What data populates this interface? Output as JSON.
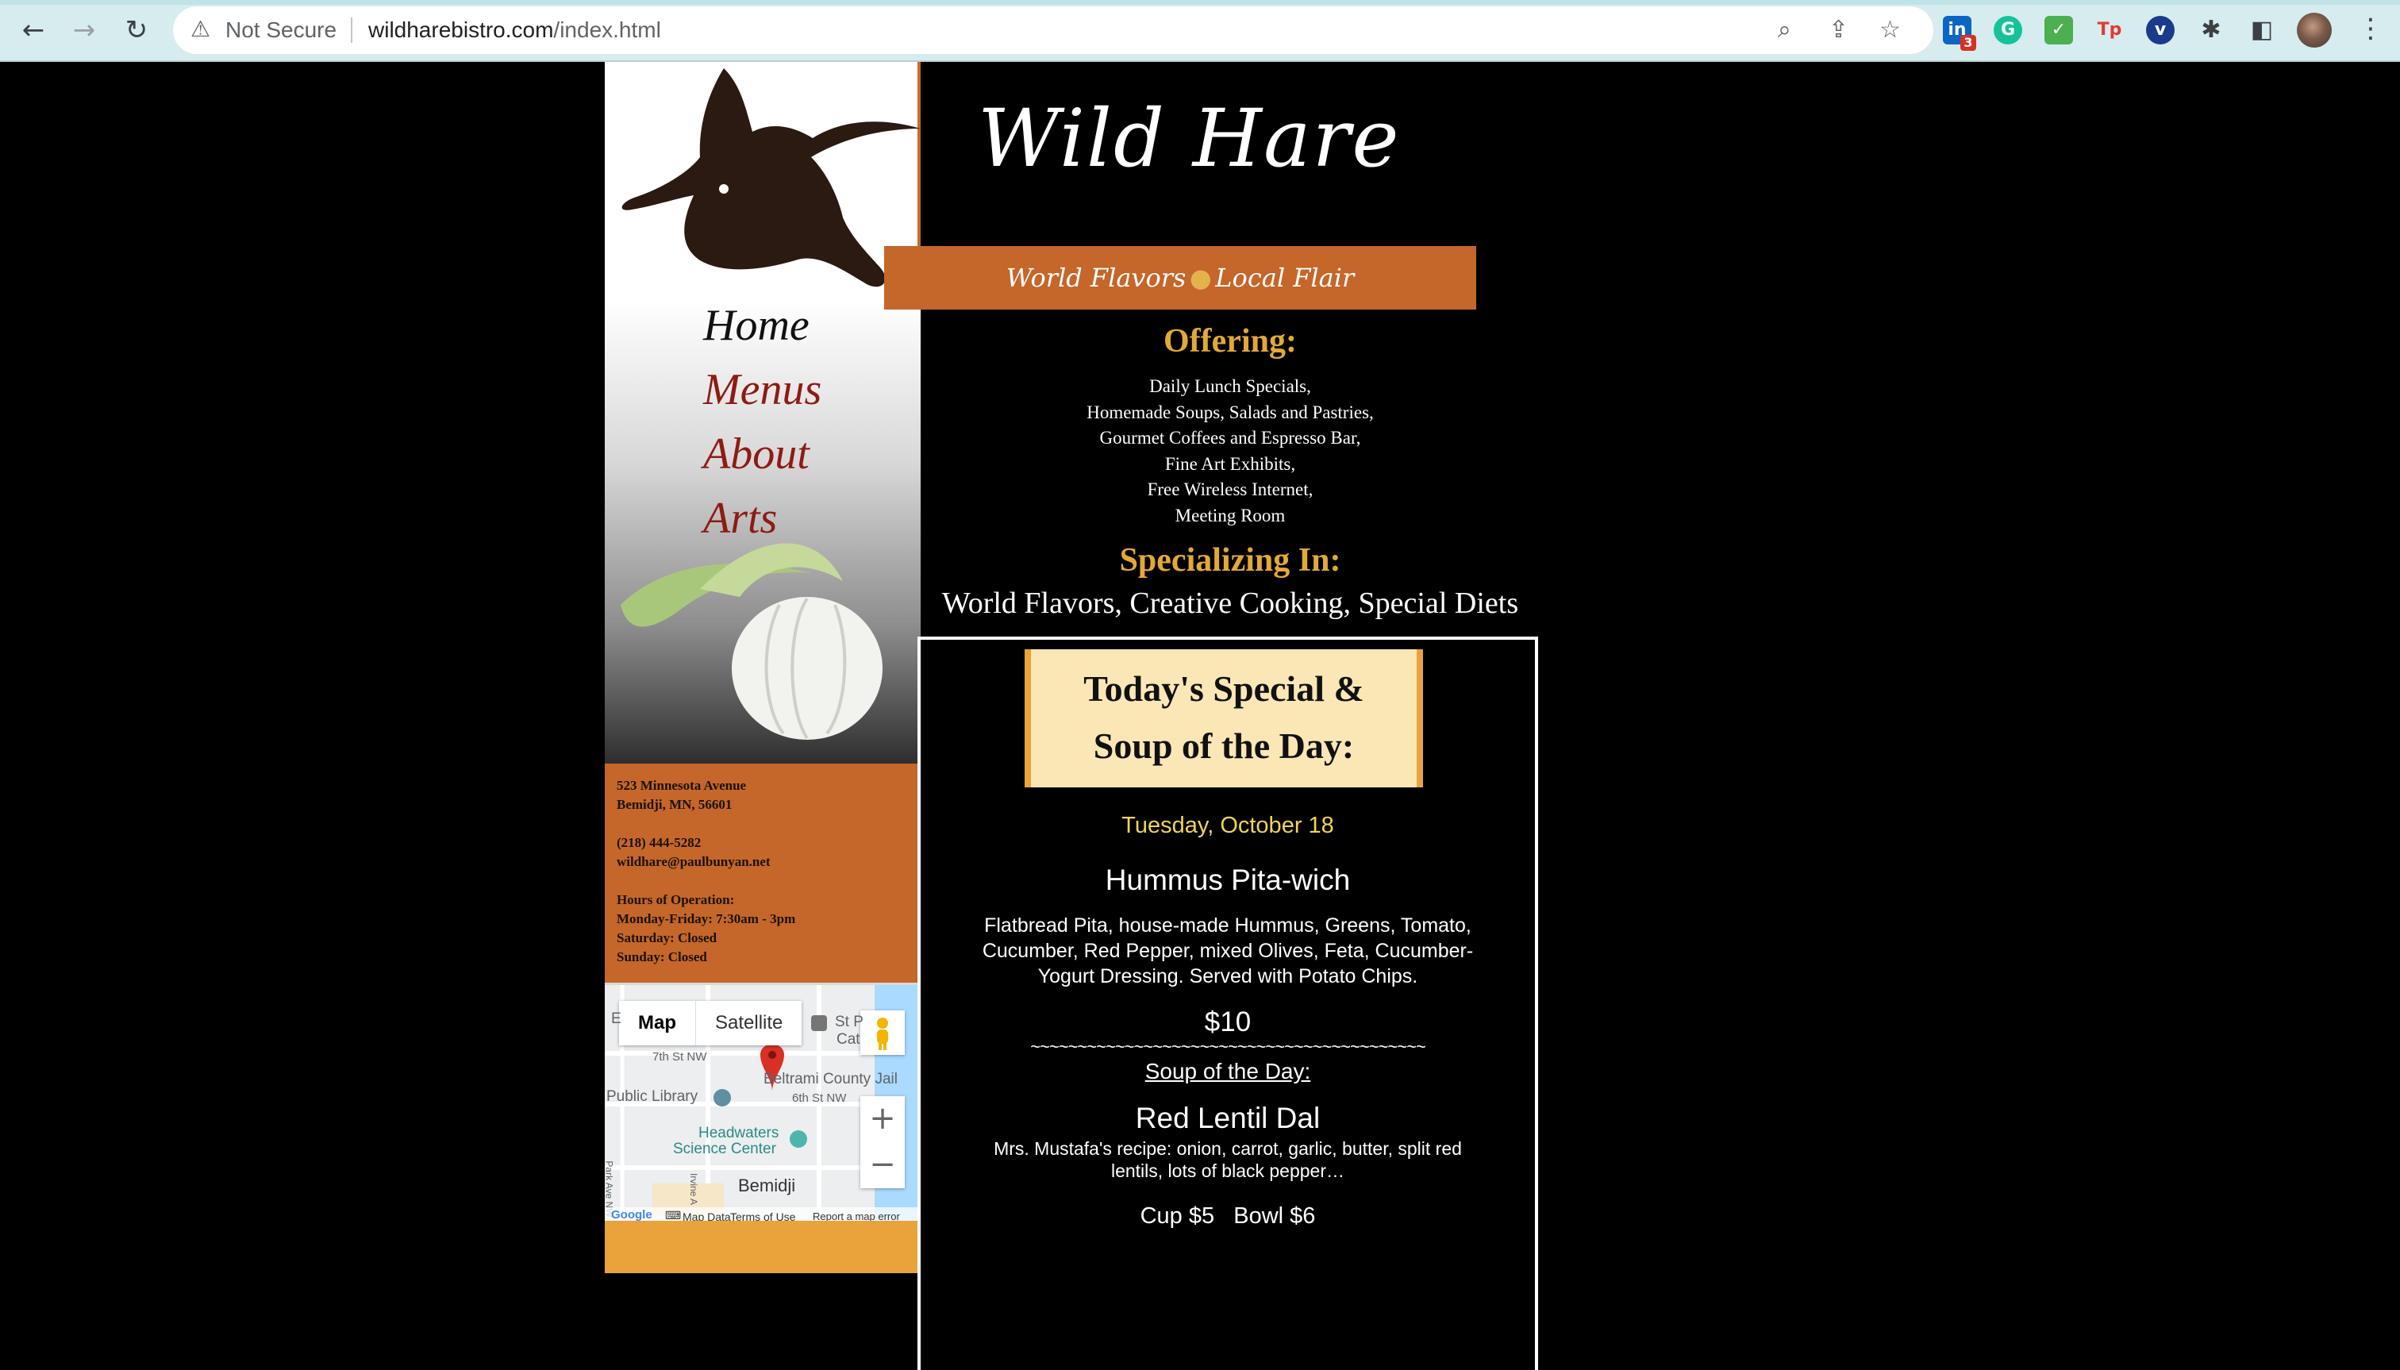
{
  "browser": {
    "not_secure": "Not Secure",
    "url_domain": "wildharebistro.com",
    "url_path": "/index.html",
    "icons": [
      "back-icon",
      "forward-icon",
      "reload-icon",
      "warning-icon",
      "zoom-icon",
      "share-icon",
      "star-icon",
      "extensions-icon",
      "sidebar-icon",
      "menu-icon"
    ],
    "extension_badge": "3"
  },
  "logo": {
    "title": "Wild Hare"
  },
  "tagline": {
    "left": "World Flavors",
    "dot": "●",
    "right": "Local Flair"
  },
  "nav": {
    "home": "Home",
    "menus": "Menus",
    "about": "About",
    "arts": "Arts"
  },
  "contact": {
    "street": "523 Minnesota Avenue",
    "city": "Bemidji, MN, 56601",
    "phone": "(218) 444-5282",
    "email": "wildhare@paulbunyan.net",
    "hours_title": "Hours of Operation:",
    "weekday": "Monday-Friday: 7:30am - 3pm",
    "saturday": "Saturday: Closed",
    "sunday": "Sunday: Closed"
  },
  "map": {
    "map_tab": "Map",
    "satellite_tab": "Satellite",
    "labels": {
      "seventh": "7th St NW",
      "library": "Public Library",
      "jail": "Beltrami County Jail",
      "sixth": "6th St NW",
      "headwaters1": "Headwaters",
      "headwaters2": "Science Center",
      "bemidji": "Bemidji",
      "stcat1": "St P",
      "stcat2": "Cat",
      "park": "Park Ave NW",
      "irvine": "Irvine A",
      "edge_e": "E"
    },
    "zoom_in": "+",
    "zoom_out": "−",
    "footer_map_data": "Map Data",
    "footer_terms": "Terms of Use",
    "footer_report": "Report a map error",
    "google": "Google"
  },
  "offering": {
    "heading": "Offering:",
    "items": [
      "Daily Lunch Specials,",
      "Homemade Soups, Salads and Pastries,",
      "Gourmet Coffees and Espresso Bar,",
      "Fine Art Exhibits,",
      "Free Wireless Internet,",
      "Meeting Room"
    ]
  },
  "specializing": {
    "heading": "Specializing In:",
    "text": "World Flavors, Creative Cooking, Special Diets"
  },
  "special": {
    "card_line1": "Today's Special &",
    "card_line2": "Soup of the Day:",
    "date": "Tuesday, October 18",
    "dish": "Hummus Pita-wich",
    "desc1": "Flatbread Pita, house-made Hummus, Greens, Tomato,",
    "desc2": "Cucumber, Red Pepper, mixed Olives, Feta, Cucumber-",
    "desc3": "Yogurt Dressing.  Served with Potato Chips.",
    "price": "$10",
    "divider": "~~~~~~~~~~~~~~~~~~~~~~~~~~~~~~~~~~~~~~~~~~",
    "soup_heading": "Soup of the Day:",
    "soup_name": "Red Lentil Dal",
    "soup_desc1": "Mrs. Mustafa's recipe:  onion, carrot, garlic, butter, split red",
    "soup_desc2": "lentils, lots of black pepper…",
    "soup_prices": "Cup $5   Bowl $6"
  },
  "colors": {
    "orange": "#c5662a",
    "gold": "#e3a936",
    "nav_red": "#8e1b14",
    "card_bg": "#fbe6b6",
    "date_yellow": "#f0d45a"
  }
}
